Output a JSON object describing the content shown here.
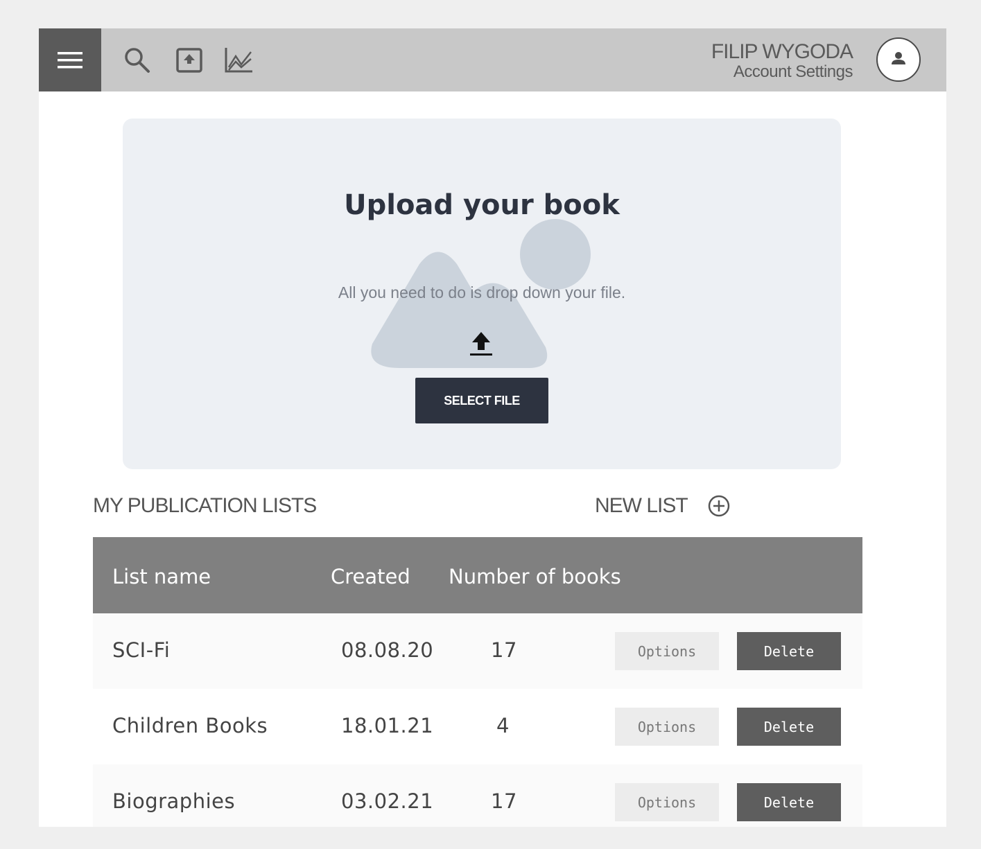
{
  "header": {
    "user_name": "FILIP WYGODA",
    "account_link": "Account Settings",
    "icons": [
      "menu-icon",
      "search-icon",
      "upload-box-icon",
      "chart-icon",
      "user-icon"
    ]
  },
  "upload": {
    "title": "Upload your book",
    "description": "All you need to do is drop down your file.",
    "button_label": "SELECT FILE"
  },
  "lists": {
    "section_title": "MY PUBLICATION LISTS",
    "new_list_label": "NEW LIST",
    "columns": [
      "List name",
      "Created",
      "Number of books"
    ],
    "rows": [
      {
        "name": "SCI-Fi",
        "created": "08.08.20",
        "count": "17"
      },
      {
        "name": "Children Books",
        "created": "18.01.21",
        "count": "4"
      },
      {
        "name": "Biographies",
        "created": "03.02.21",
        "count": "17"
      }
    ],
    "options_label": "Options",
    "delete_label": "Delete"
  },
  "colors": {
    "topbar": "#c8c8c8",
    "menu_button": "#5a5a5a",
    "primary_dark": "#2d3340",
    "table_header": "#808080",
    "delete_button": "#5e5e5e"
  }
}
